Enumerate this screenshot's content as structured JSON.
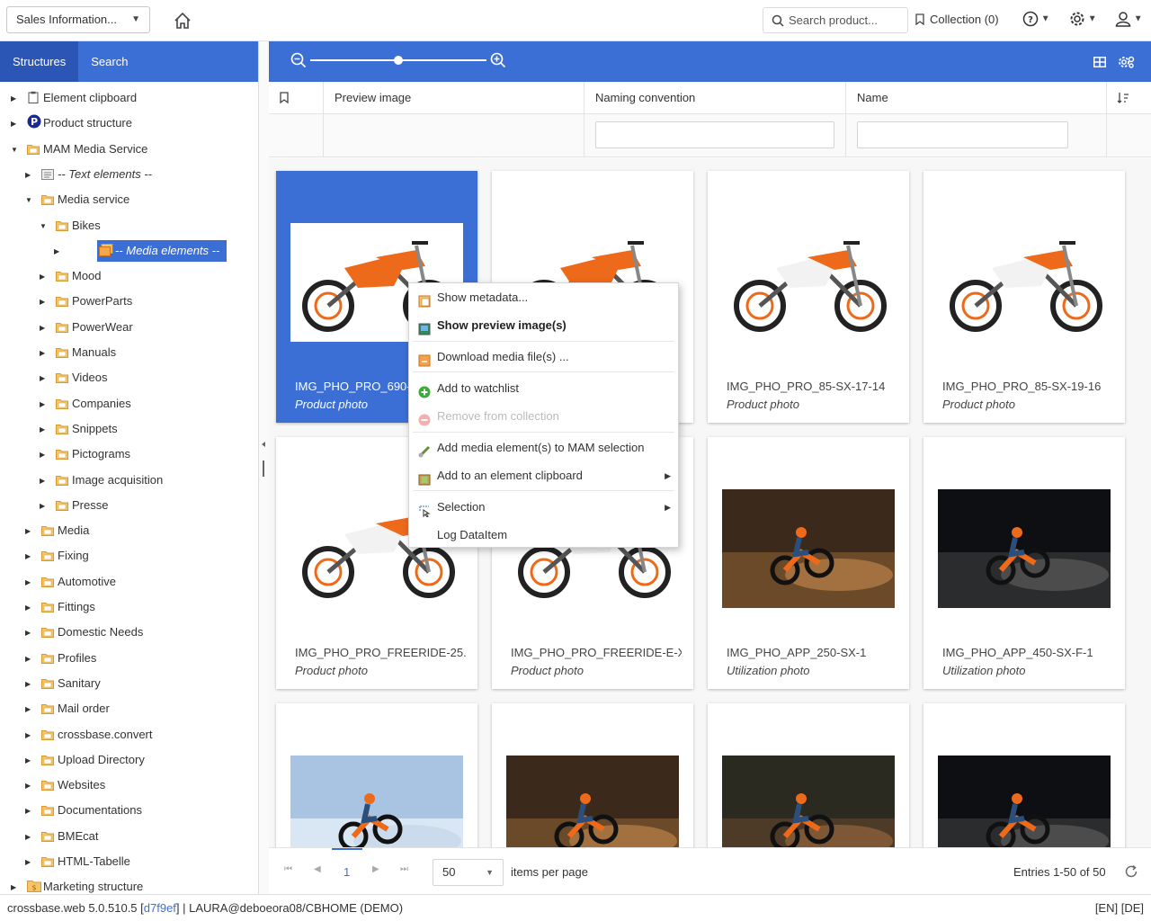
{
  "topbar": {
    "channel": "Sales Information...",
    "search_placeholder": "Search product...",
    "collection": "Collection (0)"
  },
  "left_tabs": [
    {
      "label": "Structures"
    },
    {
      "label": "Search"
    }
  ],
  "tree": [
    {
      "label": "Element clipboard",
      "level": 0,
      "state": "collapsed",
      "icon": "clipboard-icon"
    },
    {
      "label": "Product structure",
      "level": 0,
      "state": "collapsed",
      "icon": "product-p-icon"
    },
    {
      "label": "MAM Media Service",
      "level": 0,
      "state": "expanded",
      "icon": "folder-icon"
    },
    {
      "label": "-- Text elements --",
      "level": 1,
      "state": "collapsed",
      "icon": "text-elements-icon",
      "italic": true
    },
    {
      "label": "Media service",
      "level": 1,
      "state": "expanded",
      "icon": "folder-icon"
    },
    {
      "label": "Bikes",
      "level": 2,
      "state": "expanded",
      "icon": "folder-icon"
    },
    {
      "label": "-- Media elements --",
      "level": 3,
      "state": "collapsed",
      "icon": "media-elements-icon",
      "italic": true,
      "selected": true
    },
    {
      "label": "Mood",
      "level": 2,
      "state": "collapsed",
      "icon": "folder-icon"
    },
    {
      "label": "PowerParts",
      "level": 2,
      "state": "collapsed",
      "icon": "folder-icon"
    },
    {
      "label": "PowerWear",
      "level": 2,
      "state": "collapsed",
      "icon": "folder-icon"
    },
    {
      "label": "Manuals",
      "level": 2,
      "state": "collapsed",
      "icon": "folder-icon"
    },
    {
      "label": "Videos",
      "level": 2,
      "state": "collapsed",
      "icon": "folder-icon"
    },
    {
      "label": "Companies",
      "level": 2,
      "state": "collapsed",
      "icon": "folder-icon"
    },
    {
      "label": "Snippets",
      "level": 2,
      "state": "collapsed",
      "icon": "folder-icon"
    },
    {
      "label": "Pictograms",
      "level": 2,
      "state": "collapsed",
      "icon": "folder-icon"
    },
    {
      "label": "Image acquisition",
      "level": 2,
      "state": "collapsed",
      "icon": "folder-icon"
    },
    {
      "label": "Presse",
      "level": 2,
      "state": "collapsed",
      "icon": "folder-icon"
    },
    {
      "label": "Media",
      "level": 1,
      "state": "collapsed",
      "icon": "folder-icon"
    },
    {
      "label": "Fixing",
      "level": 1,
      "state": "collapsed",
      "icon": "folder-icon"
    },
    {
      "label": "Automotive",
      "level": 1,
      "state": "collapsed",
      "icon": "folder-icon"
    },
    {
      "label": "Fittings",
      "level": 1,
      "state": "collapsed",
      "icon": "folder-icon"
    },
    {
      "label": "Domestic Needs",
      "level": 1,
      "state": "collapsed",
      "icon": "folder-icon"
    },
    {
      "label": "Profiles",
      "level": 1,
      "state": "collapsed",
      "icon": "folder-icon"
    },
    {
      "label": "Sanitary",
      "level": 1,
      "state": "collapsed",
      "icon": "folder-icon"
    },
    {
      "label": "Mail order",
      "level": 1,
      "state": "collapsed",
      "icon": "folder-icon"
    },
    {
      "label": "crossbase.convert",
      "level": 1,
      "state": "collapsed",
      "icon": "folder-icon"
    },
    {
      "label": "Upload Directory",
      "level": 1,
      "state": "collapsed",
      "icon": "folder-icon"
    },
    {
      "label": "Websites",
      "level": 1,
      "state": "collapsed",
      "icon": "folder-icon"
    },
    {
      "label": "Documentations",
      "level": 1,
      "state": "collapsed",
      "icon": "folder-icon"
    },
    {
      "label": "BMEcat",
      "level": 1,
      "state": "collapsed",
      "icon": "folder-icon"
    },
    {
      "label": "HTML-Tabelle",
      "level": 1,
      "state": "collapsed",
      "icon": "folder-icon"
    },
    {
      "label": "Marketing structure",
      "level": 0,
      "state": "collapsed",
      "icon": "marketing-icon"
    }
  ],
  "zoom_level": 0.5,
  "columns": [
    "Preview image",
    "Naming convention",
    "Name"
  ],
  "cards": [
    {
      "name": "IMG_PHO_PRO_690-D",
      "type": "Product photo",
      "selected": true,
      "kind": "bike-orange"
    },
    {
      "name": "",
      "type": "",
      "kind": "bike-orange"
    },
    {
      "name": "IMG_PHO_PRO_85-SX-17-14",
      "type": "Product photo",
      "kind": "bike-white"
    },
    {
      "name": "IMG_PHO_PRO_85-SX-19-16",
      "type": "Product photo",
      "kind": "bike-white"
    },
    {
      "name": "IMG_PHO_PRO_FREERIDE-25...",
      "type": "Product photo",
      "kind": "bike-white"
    },
    {
      "name": "IMG_PHO_PRO_FREERIDE-E-XC",
      "type": "Product photo",
      "kind": "bike-white"
    },
    {
      "name": "IMG_PHO_APP_250-SX-1",
      "type": "Utilization photo",
      "kind": "action-dirt"
    },
    {
      "name": "IMG_PHO_APP_450-SX-F-1",
      "type": "Utilization photo",
      "kind": "action-night"
    },
    {
      "name": "",
      "type": "",
      "kind": "action-sky"
    },
    {
      "name": "",
      "type": "",
      "kind": "action-dirt"
    },
    {
      "name": "",
      "type": "",
      "kind": "action-dirt2"
    },
    {
      "name": "",
      "type": "",
      "kind": "action-night"
    }
  ],
  "context_menu": [
    {
      "label": "Show metadata...",
      "icon": "metadata-icon",
      "enabled": true
    },
    {
      "label": "Show preview image(s)",
      "icon": "preview-image-icon",
      "enabled": true,
      "default": true
    },
    {
      "label": "Download media file(s) ...",
      "icon": "download-icon",
      "enabled": true
    },
    {
      "label": "Add to watchlist",
      "icon": "add-watchlist-icon",
      "enabled": true
    },
    {
      "label": "Remove from collection",
      "icon": "remove-collection-icon",
      "enabled": false
    },
    {
      "label": "Add media element(s) to MAM selection",
      "icon": "mam-selection-icon",
      "enabled": true
    },
    {
      "label": "Add to an element clipboard",
      "icon": "clipboard-add-icon",
      "enabled": true,
      "submenu": true
    },
    {
      "label": "Selection",
      "icon": "selection-icon",
      "enabled": true,
      "submenu": true
    },
    {
      "label": "Log DataItem",
      "icon": "",
      "enabled": true
    }
  ],
  "pager": {
    "current_page": "1",
    "per_page": "50",
    "items_per_page_label": "items per page",
    "entries": "Entries 1-50 of 50"
  },
  "status": {
    "version": "crossbase.web 5.0.510.5 [",
    "hash": "d7f9ef",
    "user": "] | LAURA@deboeora08/CBHOME (DEMO)",
    "langs": "[EN] [DE]"
  },
  "colors": {
    "accent": "#3c6fd6",
    "accent_dark": "#2c56b5",
    "ktm_orange": "#ee6a1b"
  }
}
